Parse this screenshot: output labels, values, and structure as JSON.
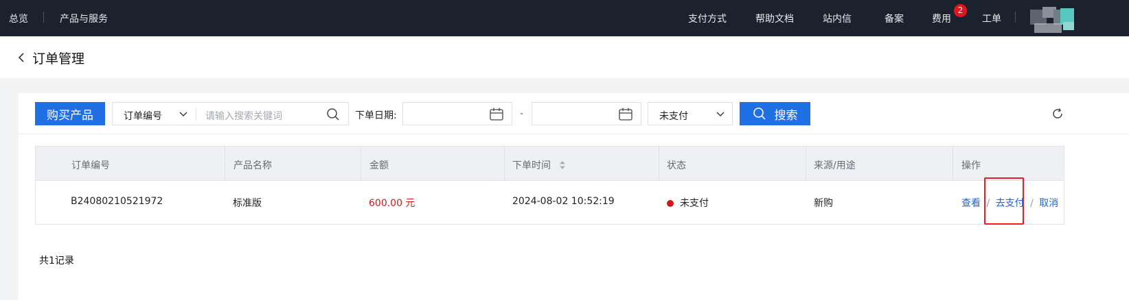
{
  "topnav": {
    "left_items": [
      "总览",
      "产品与服务"
    ],
    "right_items": [
      "支付方式",
      "帮助文档",
      "站内信",
      "备案",
      "费用",
      "工单"
    ],
    "fee_badge": "2"
  },
  "page": {
    "title": "订单管理"
  },
  "toolbar": {
    "buy_button": "购买产品",
    "filter_select": "订单编号",
    "search_placeholder": "请输入搜索关键词",
    "date_label": "下单日期:",
    "date_separator": "-",
    "status_select": "未支付",
    "search_button": "搜索"
  },
  "table": {
    "headers": [
      "订单编号",
      "产品名称",
      "金额",
      "下单时间",
      "状态",
      "来源/用途",
      "操作"
    ],
    "rows": [
      {
        "order_no": "B24080210521972",
        "product": "标准版",
        "amount": "600.00 元",
        "time": "2024-08-02 10:52:19",
        "status": "未支付",
        "source": "新购",
        "actions": [
          "查看",
          "去支付",
          "取消"
        ],
        "action_separator": "/"
      }
    ]
  },
  "footer": {
    "total": "共1记录"
  },
  "colors": {
    "primary": "#1f6fe5",
    "danger": "#d2161e",
    "nav_bg": "#1c222d",
    "highlight": "#ee1c1c"
  }
}
